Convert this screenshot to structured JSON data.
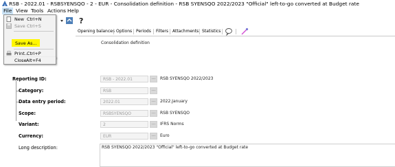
{
  "window": {
    "title": "RSB - 2022.01 - RSBSYENSQO - 2 - EUR - Consolidation definition - RSB SYENSQO 2022/2023 \"Official\" left-to-go converted at Budget rate"
  },
  "menubar": {
    "items": [
      "File",
      "View",
      "Tools",
      "Actions",
      "Help"
    ]
  },
  "file_menu": {
    "items": [
      {
        "label": "New",
        "shortcut": "Ctrl+N",
        "icon": "new-document-icon",
        "enabled": true
      },
      {
        "label": "Save",
        "shortcut": "Ctrl+S",
        "icon": "save-icon",
        "enabled": false
      },
      {
        "label": "Save As...",
        "shortcut": "",
        "icon": "",
        "enabled": true,
        "highlighted": true
      },
      {
        "label": "Print...",
        "shortcut": "Ctrl+P",
        "icon": "printer-icon",
        "enabled": true
      },
      {
        "label": "Close",
        "shortcut": "Alt+F4",
        "icon": "",
        "enabled": true
      }
    ]
  },
  "tabs": [
    "Opening balances",
    "Options",
    "Periods",
    "Filters",
    "Attachments",
    "Statistics"
  ],
  "form": {
    "header": "Consolidation definition",
    "reporting_id": {
      "label": "Reporting ID:",
      "value": "RSB - 2022.01",
      "description": "RSB SYENSQO 2022/2023"
    },
    "category": {
      "label": "Category:",
      "value": "RSB"
    },
    "data_entry_period": {
      "label": "Data entry period:",
      "value": "2022.01",
      "description": "2022.January"
    },
    "scope": {
      "label": "Scope:",
      "value": "RSBSYENSQO",
      "description": "RSB SYENSQO"
    },
    "variant": {
      "label": "Variant:",
      "value": "2",
      "description": "IFRS Norms"
    },
    "currency": {
      "label": "Currency:",
      "value": "EUR",
      "description": "Euro"
    },
    "long_description": {
      "label": "Long description:",
      "value": "RSB SYENSQO 2022/2023 \"Official\" left-to-go converted at Budget rate"
    }
  },
  "lookup_button_label": "..."
}
